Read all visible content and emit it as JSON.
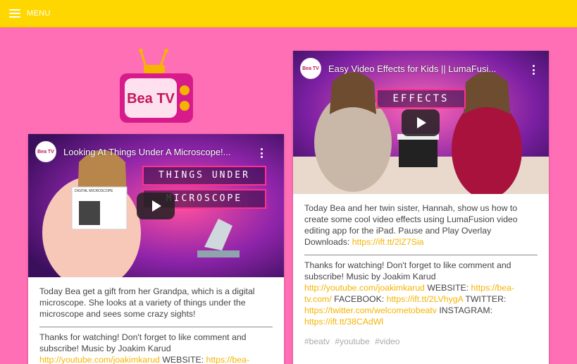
{
  "header": {
    "menu_label": "MENU"
  },
  "logo": {
    "text": "Bea TV"
  },
  "cards": [
    {
      "video_title": "Looking At Things Under A Microscope!...",
      "channel_badge": "Bea TV",
      "banner_top": "THINGS UNDER",
      "banner_bottom": "MICROSCOPE",
      "product_label": "DIGITAL MICROSCOPE",
      "description": "Today Bea get a gift from her Grandpa, which is a digital microscope. She looks at a variety of things under the microscope and sees some crazy sights!",
      "thanks": "Thanks for watching! Don't forget to like comment and subscribe! Music by Joakim Karud",
      "music_link": "http://youtube.com/joakimkarud",
      "website_label": "WEBSITE:",
      "website_link": "https://bea-"
    },
    {
      "video_title": "Easy Video Effects for Kids || LumaFusi...",
      "channel_badge": "Bea TV",
      "banner_text": "EFFECTS",
      "description": "Today Bea and her twin sister, Hannah, show us how to create some cool video effects using LumaFusion video editing app for the iPad. Pause and Play Overlay Downloads:",
      "downloads_link": "https://ift.tt/2lZ7Sia",
      "thanks": "Thanks for watching! Don't forget to like comment and subscribe! Music by Joakim Karud",
      "music_link": "http://youtube.com/joakimkarud",
      "website_label": "WEBSITE:",
      "website_link": "https://bea-tv.com/",
      "facebook_label": "FACEBOOK:",
      "facebook_link": "https://ift.tt/2LVhygA",
      "twitter_label": "TWITTER:",
      "twitter_link": "https://twitter.com/welcometobeatv",
      "instagram_label": "INSTAGRAM:",
      "instagram_link": "https://ift.tt/38CAdWl",
      "tags": [
        "#beatv",
        "#youtube",
        "#video"
      ]
    }
  ],
  "colors": {
    "topbar": "#ffd700",
    "page_bg": "#ff6fb5",
    "link": "#f4b400",
    "brand_pink": "#c2185b"
  }
}
